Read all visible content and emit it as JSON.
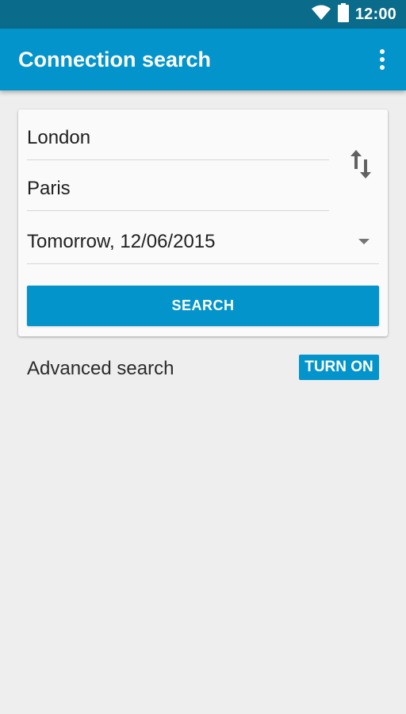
{
  "status_bar": {
    "time": "12:00",
    "wifi_icon": "wifi-icon",
    "battery_icon": "battery-icon"
  },
  "app_bar": {
    "title": "Connection search",
    "overflow_icon": "more-vert-icon",
    "color": "#0394cb"
  },
  "search_form": {
    "from_value": "London",
    "to_value": "Paris",
    "date_value": "Tomorrow, 12/06/2015",
    "swap_icon": "swap-vertical-icon",
    "dropdown_icon": "arrow-drop-down-icon",
    "search_label": "SEARCH"
  },
  "advanced": {
    "label": "Advanced search",
    "toggle_label": "TURN ON"
  },
  "colors": {
    "accent": "#0394cb",
    "status_bar": "#0a6b8a",
    "background": "#eeeeee"
  }
}
